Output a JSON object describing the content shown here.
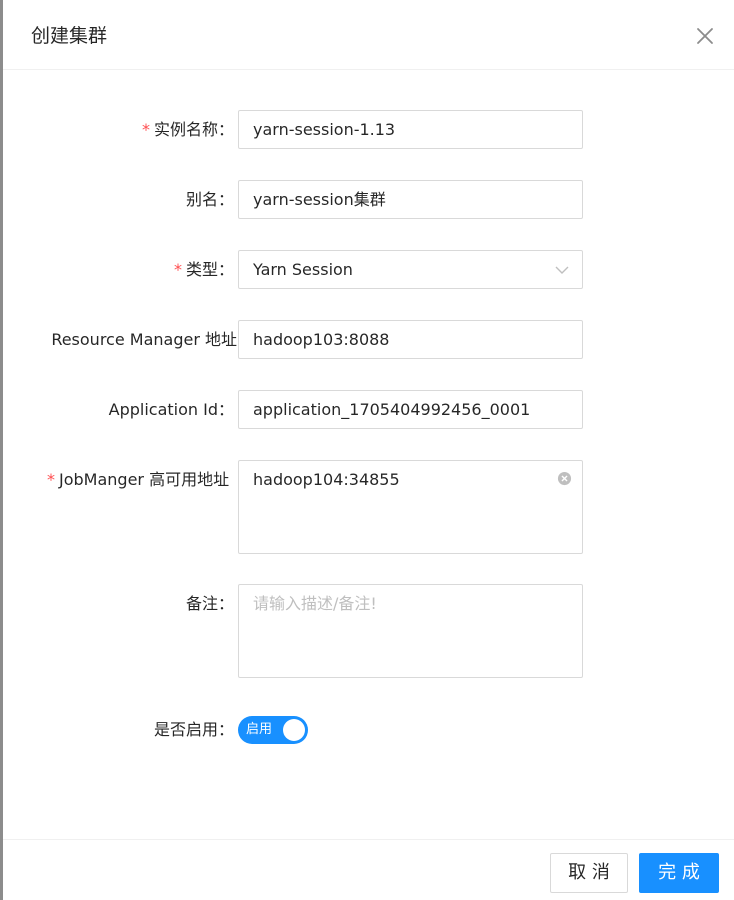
{
  "modal": {
    "title": "创建集群",
    "close_icon": "close-icon"
  },
  "form": {
    "instance_name": {
      "label": "实例名称",
      "required": "*",
      "colon": "：",
      "value": "yarn-session-1.13"
    },
    "alias": {
      "label": "别名",
      "colon": "：",
      "value": "yarn-session集群"
    },
    "type": {
      "label": "类型",
      "required": "*",
      "colon": "：",
      "value": "Yarn Session",
      "arrow_icon": "chevron-down-icon"
    },
    "resource_manager": {
      "label": "Resource Manager 地址",
      "value": "hadoop103:8088"
    },
    "application_id": {
      "label": "Application Id",
      "colon": "：",
      "value": "application_1705404992456_0001"
    },
    "jobmanager_ha": {
      "label": "JobManger 高可用地址",
      "required": "*",
      "value": "hadoop104:34855",
      "clear_icon": "clear-circle-icon"
    },
    "remark": {
      "label": "备注",
      "colon": "：",
      "placeholder": "请输入描述/备注!"
    },
    "enabled": {
      "label": "是否启用",
      "colon": "：",
      "switch_text": "启用",
      "checked": true
    }
  },
  "footer": {
    "cancel_label": "取 消",
    "ok_label": "完 成"
  },
  "colors": {
    "primary": "#1890ff",
    "required": "#ff4d4f",
    "border": "#d9d9d9",
    "placeholder": "#bfbfbf"
  }
}
